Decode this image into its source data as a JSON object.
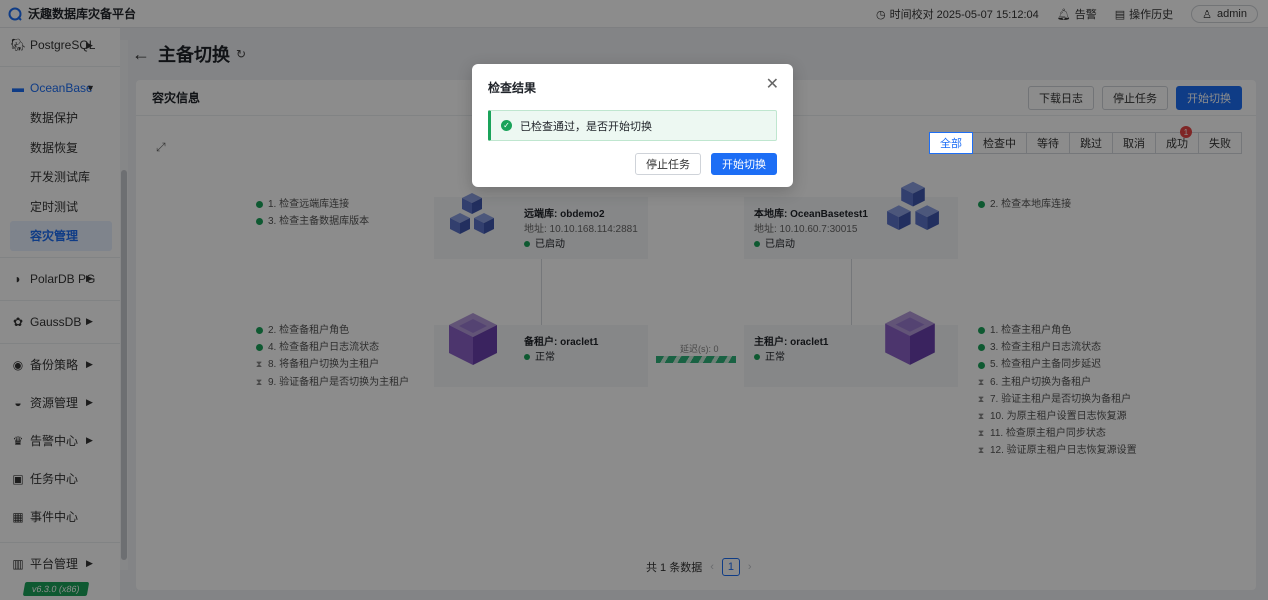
{
  "app": {
    "title": "沃趣数据库灾备平台"
  },
  "topbar": {
    "time_check": "时间校对 2025-05-07 15:12:04",
    "alarm": "告警",
    "history": "操作历史",
    "user": "admin"
  },
  "sidebar": {
    "groups": [
      {
        "label": "PostgreSQL",
        "icon": "postgresql-icon"
      },
      {
        "label": "OceanBase",
        "icon": "oceanbase-icon"
      },
      {
        "label": "PolarDB PG",
        "icon": "polardb-icon"
      },
      {
        "label": "GaussDB",
        "icon": "gaussdb-icon"
      },
      {
        "label": "备份策略",
        "icon": "backup-policy-icon"
      },
      {
        "label": "资源管理",
        "icon": "resource-icon"
      },
      {
        "label": "告警中心",
        "icon": "alarm-icon"
      },
      {
        "label": "任务中心",
        "icon": "task-icon"
      },
      {
        "label": "事件中心",
        "icon": "event-icon"
      },
      {
        "label": "平台管理",
        "icon": "platform-icon"
      }
    ],
    "oceanbase_items": [
      "数据保护",
      "数据恢复",
      "开发测试库",
      "定时测试",
      "容灾管理"
    ],
    "version": "v6.3.0 (x86)"
  },
  "page": {
    "title": "主备切换"
  },
  "card": {
    "title": "容灾信息",
    "actions": [
      "下载日志",
      "停止任务",
      "开始切换"
    ],
    "filters": [
      "全部",
      "检查中",
      "等待",
      "跳过",
      "取消",
      "成功",
      "失败"
    ],
    "success_badge": "1"
  },
  "nodes": {
    "remote": {
      "name": "远端库: obdemo2",
      "addr": "地址: 10.10.168.114:2881",
      "status": "已启动"
    },
    "local": {
      "name": "本地库: OceanBasetest1",
      "addr": "地址: 10.10.60.7:30015",
      "status": "已启动"
    },
    "standby": {
      "name": "备租户: oraclet1",
      "status": "正常"
    },
    "primary": {
      "name": "主租户: oraclet1",
      "status": "正常"
    },
    "lag_label": "延迟(s): 0"
  },
  "steps": {
    "remote": [
      {
        "text": "1. 检查远端库连接",
        "done": true
      },
      {
        "text": "3. 检查主备数据库版本",
        "done": true
      }
    ],
    "local": [
      {
        "text": "2. 检查本地库连接",
        "done": true
      }
    ],
    "standby": [
      {
        "text": "2. 检查备租户角色",
        "done": true
      },
      {
        "text": "4. 检查备租户日志流状态",
        "done": true
      },
      {
        "text": "8. 将备租户切换为主租户",
        "done": false
      },
      {
        "text": "9. 验证备租户是否切换为主租户",
        "done": false
      }
    ],
    "primary": [
      {
        "text": "1. 检查主租户角色",
        "done": true
      },
      {
        "text": "3. 检查主租户日志流状态",
        "done": true
      },
      {
        "text": "5. 检查租户主备同步延迟",
        "done": true
      },
      {
        "text": "6. 主租户切换为备租户",
        "done": false
      },
      {
        "text": "7. 验证主租户是否切换为备租户",
        "done": false
      },
      {
        "text": "10. 为原主租户设置日志恢复源",
        "done": false
      },
      {
        "text": "11. 检查原主租户同步状态",
        "done": false
      },
      {
        "text": "12. 验证原主租户日志恢复源设置",
        "done": false
      }
    ]
  },
  "pager": {
    "total": "共 1 条数据",
    "current": "1"
  },
  "modal": {
    "title": "检查结果",
    "message": "已检查通过，是否开始切换",
    "cancel": "停止任务",
    "confirm": "开始切换"
  }
}
